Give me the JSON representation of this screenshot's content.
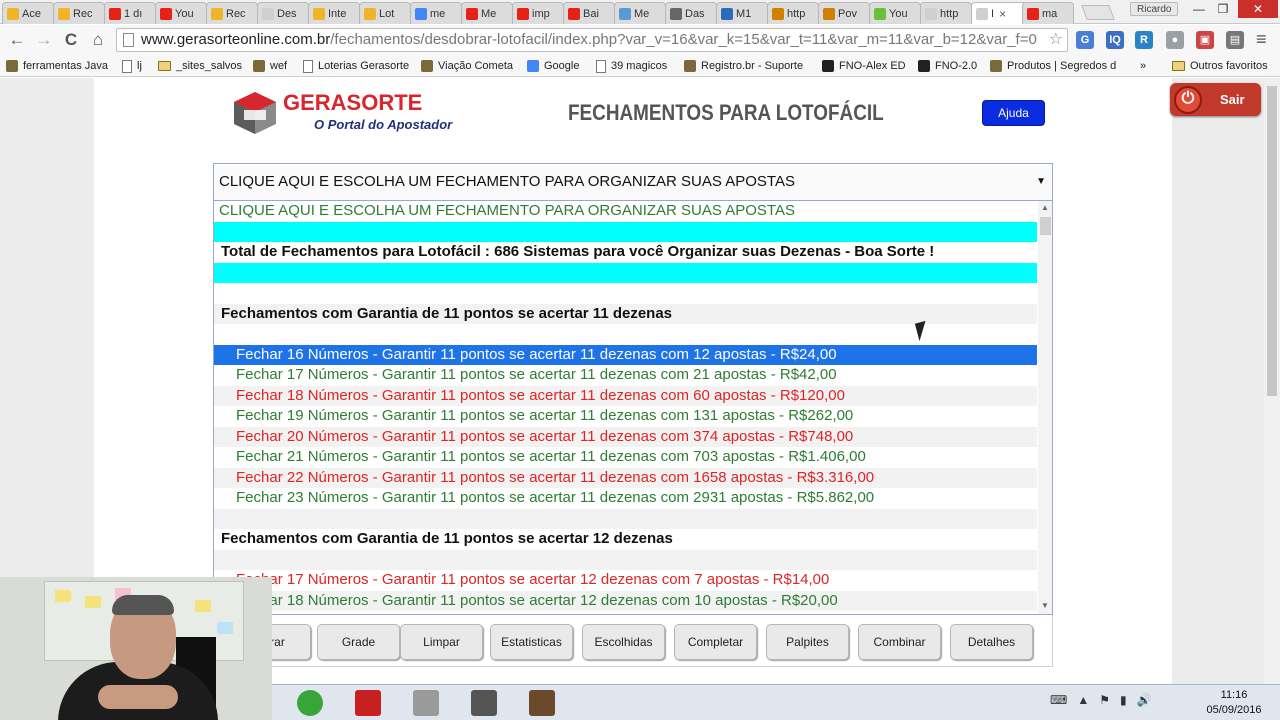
{
  "browser": {
    "tabs": [
      {
        "label": "Ace",
        "color": "#f0b429"
      },
      {
        "label": "Rec",
        "color": "#f0b429"
      },
      {
        "label": "1 dı",
        "color": "#e62117"
      },
      {
        "label": "You",
        "color": "#e62117"
      },
      {
        "label": "Rec",
        "color": "#f0b429"
      },
      {
        "label": "Des",
        "color": "#cfcfcf"
      },
      {
        "label": "Inte",
        "color": "#f0b429"
      },
      {
        "label": "Lot",
        "color": "#f0b429"
      },
      {
        "label": "me",
        "color": "#4285f4"
      },
      {
        "label": "Me",
        "color": "#e62117"
      },
      {
        "label": "imp",
        "color": "#e62117"
      },
      {
        "label": "Bai",
        "color": "#e62117"
      },
      {
        "label": "Me",
        "color": "#5a9bd5"
      },
      {
        "label": "Das",
        "color": "#666666"
      },
      {
        "label": "M1",
        "color": "#2a6ebb"
      },
      {
        "label": "http",
        "color": "#d08000"
      },
      {
        "label": "Pov",
        "color": "#d08000"
      },
      {
        "label": "You",
        "color": "#6abf40"
      },
      {
        "label": "http",
        "color": "#cfcfcf"
      },
      {
        "label": "I",
        "color": "#cfcfcf",
        "active": true
      },
      {
        "label": "ma",
        "color": "#e62117"
      }
    ],
    "tab_close": "×",
    "user": "Ricardo",
    "window_controls": {
      "minimize": "—",
      "restore": "❐",
      "close": "✕"
    },
    "nav": {
      "back": "←",
      "forward": "→",
      "reload": "C",
      "home": "⌂"
    },
    "url_host": "www.gerasorteonline.com.br",
    "url_path": "/fechamentos/desdobrar-lotofacil/index.php?var_v=16&var_k=15&var_t=11&var_m=11&var_b=12&var_f=0",
    "star": "☆",
    "extensions": [
      {
        "label": "G",
        "color": "#4a7fd6"
      },
      {
        "label": "IQ",
        "color": "#3b6fc4"
      },
      {
        "label": "R",
        "color": "#2a83c6"
      },
      {
        "label": "●",
        "color": "#9aa0a6"
      },
      {
        "label": "▣",
        "color": "#c44"
      },
      {
        "label": "▤",
        "color": "#777"
      }
    ],
    "menu": "≡",
    "bookmarks": [
      {
        "label": "ferramentas Java",
        "icon": "tool-icon"
      },
      {
        "label": "lj",
        "icon": "doc-icon"
      },
      {
        "label": "_sites_salvos",
        "icon": "folder-icon"
      },
      {
        "label": "wef",
        "icon": "gear-icon"
      },
      {
        "label": "Loterias Gerasorte",
        "icon": "doc-icon"
      },
      {
        "label": "Viação Cometa",
        "icon": "image-icon"
      },
      {
        "label": "Google",
        "icon": "google-icon"
      },
      {
        "label": "39 magicos",
        "icon": "doc-icon"
      },
      {
        "label": "Registro.br - Suporte",
        "icon": "registro-icon"
      },
      {
        "label": "FNO-Alex ED",
        "icon": "g-icon"
      },
      {
        "label": "FNO-2.0",
        "icon": "g-icon"
      },
      {
        "label": "Produtos | Segredos d",
        "icon": "image-icon"
      }
    ],
    "bookmarks_overflow": "»",
    "other_bookmarks": "Outros favoritos"
  },
  "page": {
    "logo_main": "GERASORTE",
    "logo_sub": "O Portal do Apostador",
    "heading": "FECHAMENTOS PARA LOTOFÁCIL",
    "help_button": "Ajuda",
    "logout_button": "Sair",
    "select_value": "CLIQUE AQUI E ESCOLHA UM FECHAMENTO PARA ORGANIZAR SUAS APOSTAS",
    "select_caret": "▼",
    "dropdown_options": [
      {
        "text": "CLIQUE AQUI E ESCOLHA UM FECHAMENTO PARA ORGANIZAR SUAS APOSTAS",
        "style": "plain"
      },
      {
        "text": "",
        "style": "cyan"
      },
      {
        "text": "Total de Fechamentos para Lotofácil : 686 Sistemas para você Organizar suas Dezenas - Boa Sorte !",
        "style": "bold"
      },
      {
        "text": "",
        "style": "cyan"
      },
      {
        "text": "",
        "style": "blank"
      },
      {
        "text": "Fechamentos com Garantia de 11 pontos se acertar 11 dezenas",
        "style": "bold gray"
      },
      {
        "text": "",
        "style": "blank"
      },
      {
        "text": "Fechar 16 Números - Garantir 11 pontos se acertar 11 dezenas com 12 apostas - R$24,00",
        "style": "item selected"
      },
      {
        "text": "Fechar 17 Números - Garantir 11 pontos se acertar 11 dezenas com 21 apostas - R$42,00",
        "style": "item green"
      },
      {
        "text": "Fechar 18 Números - Garantir 11 pontos se acertar 11 dezenas com 60 apostas - R$120,00",
        "style": "item red gray"
      },
      {
        "text": "Fechar 19 Números - Garantir 11 pontos se acertar 11 dezenas com 131 apostas - R$262,00",
        "style": "item green"
      },
      {
        "text": "Fechar 20 Números - Garantir 11 pontos se acertar 11 dezenas com 374 apostas - R$748,00",
        "style": "item red gray"
      },
      {
        "text": "Fechar 21 Números - Garantir 11 pontos se acertar 11 dezenas com 703 apostas - R$1.406,00",
        "style": "item green"
      },
      {
        "text": "Fechar 22 Números - Garantir 11 pontos se acertar 11 dezenas com 1658 apostas - R$3.316,00",
        "style": "item red gray"
      },
      {
        "text": "Fechar 23 Números - Garantir 11 pontos se acertar 11 dezenas com 2931 apostas - R$5.862,00",
        "style": "item green"
      },
      {
        "text": "",
        "style": "blank gray"
      },
      {
        "text": "Fechamentos com Garantia de 11 pontos se acertar 12 dezenas",
        "style": "bold"
      },
      {
        "text": "",
        "style": "blank gray"
      },
      {
        "text": "Fechar 17 Números - Garantir 11 pontos se acertar 12 dezenas com 7 apostas - R$14,00",
        "style": "item red"
      },
      {
        "text": "Fechar 18 Números - Garantir 11 pontos se acertar 12 dezenas com 10 apostas - R$20,00",
        "style": "item green gray"
      }
    ],
    "scroll_up": "▲",
    "scroll_down": "▼",
    "action_buttons": [
      "Gerar",
      "Grade",
      "Limpar",
      "Estatisticas",
      "Escolhidas",
      "Completar",
      "Palpites",
      "Combinar",
      "Detalhes"
    ]
  },
  "taskbar": {
    "apps": [
      {
        "name": "chrome-icon",
        "open": true
      },
      {
        "name": "dreamweaver-icon",
        "open": false
      },
      {
        "name": "filezilla-icon",
        "open": false
      },
      {
        "name": "tool-icon",
        "open": false
      },
      {
        "name": "terminal-icon",
        "open": false
      },
      {
        "name": "recorder-icon",
        "open": false
      }
    ],
    "tray": [
      "⌨",
      "▲",
      "⚑",
      "▮",
      "🔊"
    ],
    "time": "11:16",
    "date": "05/09/2016"
  }
}
